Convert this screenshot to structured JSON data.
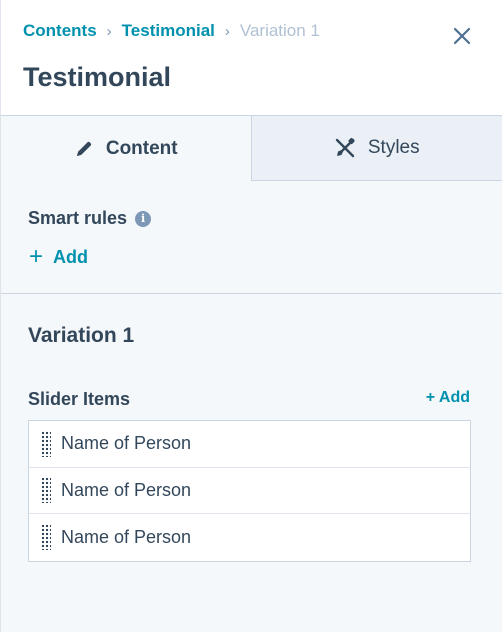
{
  "header": {
    "breadcrumbs": [
      {
        "label": "Contents"
      },
      {
        "label": "Testimonial"
      },
      {
        "label": "Variation 1"
      }
    ],
    "separator": "›",
    "title": "Testimonial"
  },
  "tabs": [
    {
      "label": "Content",
      "icon": "pencil-icon",
      "active": true
    },
    {
      "label": "Styles",
      "icon": "brush-icon",
      "active": false
    }
  ],
  "smart_rules": {
    "label": "Smart rules",
    "info_glyph": "i",
    "add_label": "Add",
    "add_glyph": "+"
  },
  "variation": {
    "title": "Variation 1",
    "slider_label": "Slider Items",
    "slider_add_label": "+ Add",
    "items": [
      {
        "label": "Name of Person"
      },
      {
        "label": "Name of Person"
      },
      {
        "label": "Name of Person"
      }
    ]
  },
  "colors": {
    "accent": "#0091ae",
    "text": "#33475b",
    "muted": "#b0c1d4",
    "border": "#cbd6e2",
    "background": "#f5f8fa",
    "inactive_tab": "#eaf0f6"
  }
}
